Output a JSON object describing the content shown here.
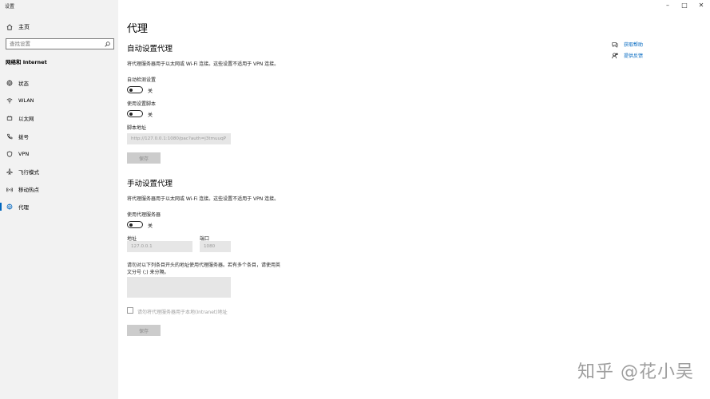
{
  "window": {
    "title": "设置",
    "controls": {
      "minimize": "–",
      "maximize": "□",
      "close": "✕"
    }
  },
  "sidebar": {
    "home_label": "主页",
    "search_placeholder": "查找设置",
    "section_header": "网络和 Internet",
    "items": [
      {
        "label": "状态",
        "icon": "globe-status-icon"
      },
      {
        "label": "WLAN",
        "icon": "wifi-icon"
      },
      {
        "label": "以太网",
        "icon": "ethernet-icon"
      },
      {
        "label": "拨号",
        "icon": "dialup-icon"
      },
      {
        "label": "VPN",
        "icon": "vpn-icon"
      },
      {
        "label": "飞行模式",
        "icon": "airplane-icon"
      },
      {
        "label": "移动热点",
        "icon": "hotspot-icon"
      },
      {
        "label": "代理",
        "icon": "globe-icon",
        "active": true
      }
    ]
  },
  "main": {
    "page_title": "代理",
    "auto": {
      "heading": "自动设置代理",
      "description": "将代理服务器用于以太网或 Wi-Fi 连接。这些设置不适用于 VPN 连接。",
      "detect_label": "自动检测设置",
      "detect_state": "关",
      "script_label": "使用设置脚本",
      "script_state": "关",
      "address_label": "脚本地址",
      "address_value": "http://127.0.0.1:1080/pac?auth=j3tmuuqP",
      "save_label": "保存"
    },
    "manual": {
      "heading": "手动设置代理",
      "description": "将代理服务器用于以太网或 Wi-Fi 连接。这些设置不适用于 VPN 连接。",
      "use_proxy_label": "使用代理服务器",
      "use_proxy_state": "关",
      "address_label": "地址",
      "address_value": "127.0.0.1",
      "port_label": "端口",
      "port_value": "1080",
      "exceptions_line1": "请勿对以下列条目开头的地址使用代理服务器。若有多个条目，请使用英",
      "exceptions_line2": "文分号 (;) 来分隔。",
      "exceptions_value": "",
      "local_checkbox_label": "请勿将代理服务器用于本地(Intranet)地址",
      "save_label": "保存"
    },
    "help": {
      "get_help": "获取帮助",
      "feedback": "提供反馈"
    },
    "watermark": "知乎 @花小吴"
  },
  "colors": {
    "accent": "#0067c0",
    "sidebar_bg": "#f2f2f2",
    "field_bg": "#e6e6e6",
    "button_bg": "#cccccc"
  }
}
